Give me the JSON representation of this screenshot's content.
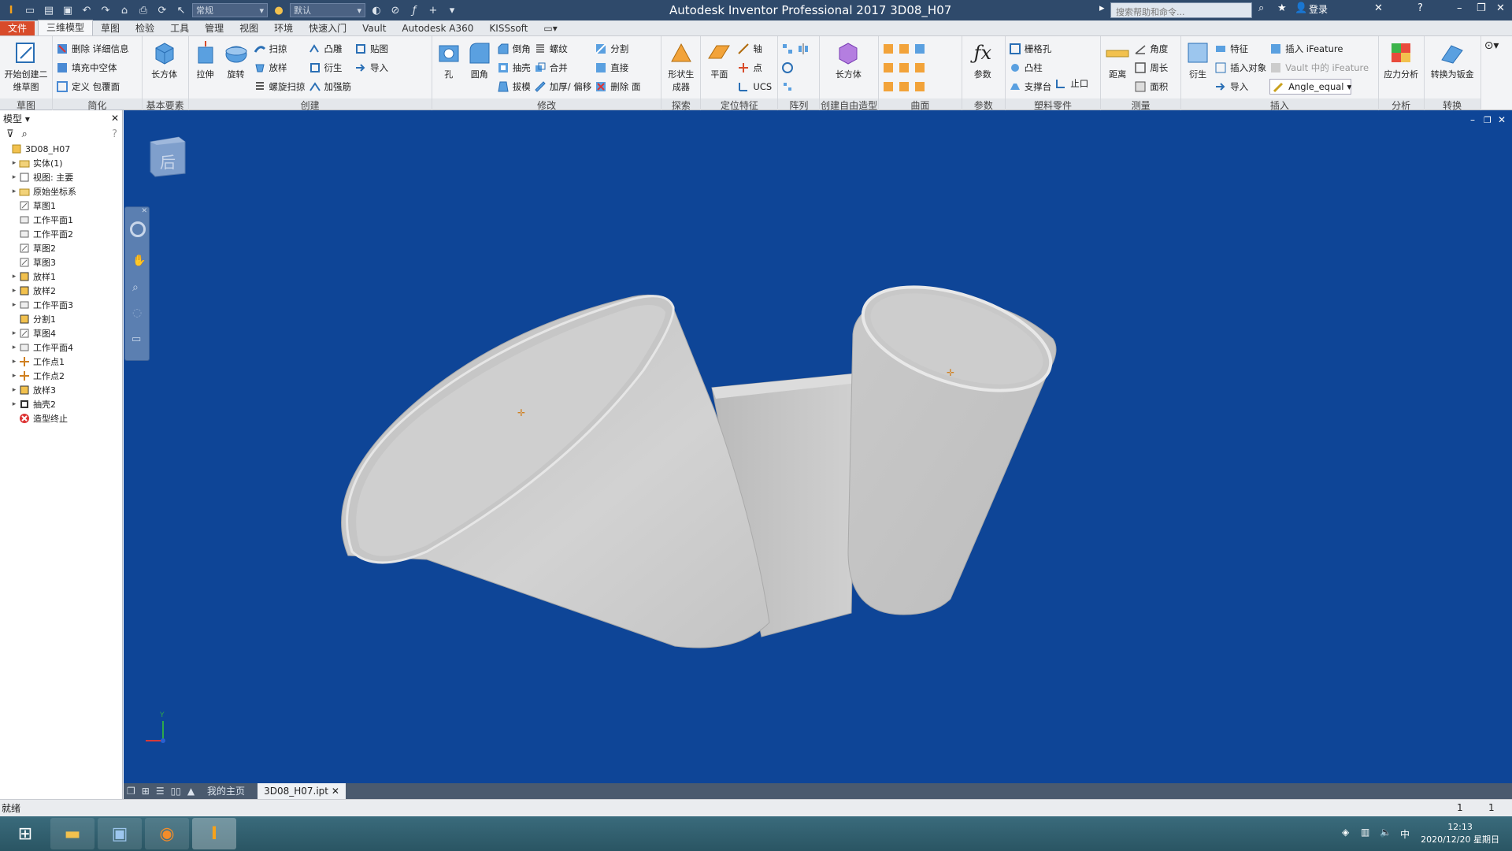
{
  "titlebar": {
    "app_title": "Autodesk Inventor Professional 2017    3D08_H07",
    "style_combo": "常规",
    "appearance_combo": "默认",
    "help_placeholder": "搜索帮助和命令...",
    "login": "登录"
  },
  "tabs": [
    "文件",
    "三维模型",
    "草图",
    "检验",
    "工具",
    "管理",
    "视图",
    "环境",
    "快速入门",
    "Vault",
    "Autodesk A360",
    "KISSsoft"
  ],
  "ribbon": {
    "sketch": {
      "title": "草图",
      "start": "开始创建二维草图"
    },
    "simplify": {
      "title": "简化",
      "items": [
        "删除 详细信息",
        "填充中空体",
        "定义 包覆面"
      ]
    },
    "primitives": {
      "title": "基本要素",
      "box": "长方体"
    },
    "create": {
      "title": "创建",
      "extrude": "拉伸",
      "revolve": "旋转",
      "col1": [
        "扫掠",
        "放样",
        "螺旋扫掠"
      ],
      "col2": [
        "凸雕",
        "衍生",
        "加强筋"
      ],
      "col3": [
        "贴图",
        "导入"
      ]
    },
    "modify": {
      "title": "修改",
      "hole": "孔",
      "fillet": "圆角",
      "col1": [
        "倒角",
        "抽壳",
        "拔模"
      ],
      "col2": [
        "螺纹",
        "合并",
        "加厚/ 偏移"
      ],
      "col3": [
        "分割",
        "直接",
        "删除 面"
      ]
    },
    "explore": {
      "title": "探索",
      "shape": "形状生成器"
    },
    "workfeatures": {
      "title": "定位特征",
      "plane": "平面",
      "items": [
        "轴",
        "点",
        "UCS"
      ]
    },
    "pattern": {
      "title": "阵列"
    },
    "freeform": {
      "title": "创建自由造型",
      "box": "长方体"
    },
    "surface": {
      "title": "曲面"
    },
    "params": {
      "title": "参数",
      "label": "参数"
    },
    "plastic": {
      "title": "塑料零件",
      "items": [
        "栅格孔",
        "凸柱",
        "支撑台",
        "止口"
      ]
    },
    "measure": {
      "title": "测量",
      "distance": "距离",
      "items": [
        "角度",
        "周长",
        "面积"
      ]
    },
    "insert": {
      "title": "插入",
      "derive": "衍生",
      "col1": [
        "特征",
        "插入对象",
        "导入"
      ],
      "col2": [
        "插入 iFeature",
        "Vault 中的 iFeature"
      ],
      "combo": "Angle_equal"
    },
    "analysis": {
      "title": "分析",
      "stress": "应力分析"
    },
    "convert": {
      "title": "转换",
      "sheet": "转换为钣金"
    }
  },
  "browser": {
    "title": "模型",
    "items": [
      {
        "label": "3D08_H07",
        "exp": "",
        "indent": 0,
        "icon": "part"
      },
      {
        "label": "实体(1)",
        "exp": "▸",
        "indent": 1,
        "icon": "folder"
      },
      {
        "label": "视图: 主要",
        "exp": "▸",
        "indent": 1,
        "icon": "view"
      },
      {
        "label": "原始坐标系",
        "exp": "▸",
        "indent": 1,
        "icon": "folder"
      },
      {
        "label": "草图1",
        "exp": "",
        "indent": 1,
        "icon": "sketch"
      },
      {
        "label": "工作平面1",
        "exp": "",
        "indent": 1,
        "icon": "plane"
      },
      {
        "label": "工作平面2",
        "exp": "",
        "indent": 1,
        "icon": "plane"
      },
      {
        "label": "草图2",
        "exp": "",
        "indent": 1,
        "icon": "sketch"
      },
      {
        "label": "草图3",
        "exp": "",
        "indent": 1,
        "icon": "sketch"
      },
      {
        "label": "放样1",
        "exp": "▸",
        "indent": 1,
        "icon": "loft"
      },
      {
        "label": "放样2",
        "exp": "▸",
        "indent": 1,
        "icon": "loft"
      },
      {
        "label": "工作平面3",
        "exp": "▸",
        "indent": 1,
        "icon": "plane"
      },
      {
        "label": "分割1",
        "exp": "",
        "indent": 1,
        "icon": "loft"
      },
      {
        "label": "草图4",
        "exp": "▸",
        "indent": 1,
        "icon": "sketch"
      },
      {
        "label": "工作平面4",
        "exp": "▸",
        "indent": 1,
        "icon": "plane"
      },
      {
        "label": "工作点1",
        "exp": "▸",
        "indent": 1,
        "icon": "point"
      },
      {
        "label": "工作点2",
        "exp": "▸",
        "indent": 1,
        "icon": "point"
      },
      {
        "label": "放样3",
        "exp": "▸",
        "indent": 1,
        "icon": "loft"
      },
      {
        "label": "抽壳2",
        "exp": "▸",
        "indent": 1,
        "icon": "shell"
      },
      {
        "label": "造型终止",
        "exp": "",
        "indent": 1,
        "icon": "end"
      }
    ]
  },
  "viewcube": {
    "face": "后"
  },
  "doctabs": {
    "home": "我的主页",
    "file": "3D08_H07.ipt"
  },
  "status": {
    "text": "就绪",
    "n1": "1",
    "n2": "1"
  },
  "taskbar": {
    "time": "12:13",
    "date": "2020/12/20 星期日",
    "ime": "中"
  },
  "colors": {
    "viewport_bg": "#0e4597",
    "model": "#c9c9c9",
    "accent": "#d84b2a"
  }
}
